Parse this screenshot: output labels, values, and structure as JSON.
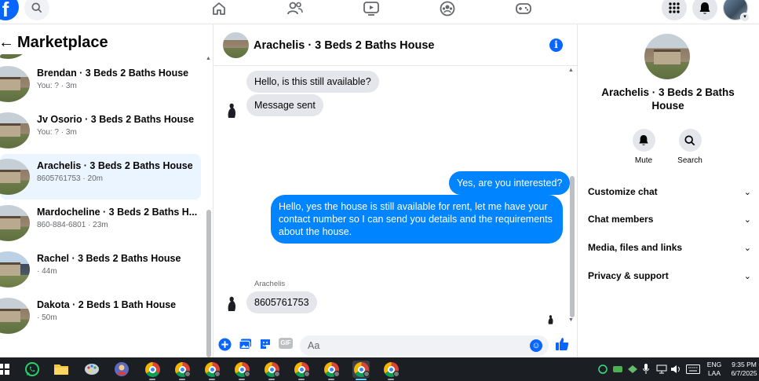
{
  "topbar": {
    "logo_letter": "f",
    "icons": [
      "search-icon",
      "home-icon",
      "friends-icon",
      "watch-icon",
      "groups-icon",
      "gaming-icon",
      "menu-icon",
      "notifications-icon",
      "profile-avatar"
    ]
  },
  "sidebar": {
    "title": "Marketplace",
    "conversations": [
      {
        "name": "Brendan · 3 Beds 2 Baths House",
        "sub": "You: ? · 3m"
      },
      {
        "name": "Jv Osorio · 3 Beds 2 Baths House",
        "sub": "You: ? · 3m"
      },
      {
        "name": "Arachelis · 3 Beds 2 Baths House",
        "sub": "8605761753 · 20m",
        "active": true
      },
      {
        "name": "Mardocheline · 3 Beds 2 Baths H...",
        "sub": "860-884-6801 · 23m"
      },
      {
        "name": "Rachel · 3 Beds 2 Baths House",
        "sub": "· 44m"
      },
      {
        "name": "Dakota · 2 Beds 1 Bath House",
        "sub": "· 50m"
      }
    ]
  },
  "chat": {
    "title": "Arachelis · 3 Beds 2 Baths House",
    "messages": {
      "in1": "Hello, is this still available?",
      "in2": "Message sent",
      "out1": "Yes, are you interested?",
      "out2": "Hello, yes the house is still available for rent, let me have your contact number so I can send you details and the requirements about the house.",
      "sender_label": "Arachelis",
      "in3": "8605761753"
    },
    "composer": {
      "placeholder": "Aa",
      "gif_label": "GIF"
    }
  },
  "details": {
    "name": "Arachelis · 3 Beds 2 Baths House",
    "actions": {
      "mute": "Mute",
      "search": "Search"
    },
    "sections": [
      "Customize chat",
      "Chat members",
      "Media, files and links",
      "Privacy & support"
    ]
  },
  "taskbar": {
    "lang": "ENG",
    "layout": "LAA",
    "time": "9:35 PM",
    "date": "6/7/2025"
  },
  "colors": {
    "brand_blue": "#0866ff",
    "outgoing_bubble": "#0084ff",
    "incoming_bubble": "#e4e6eb",
    "active_row": "#ebf5ff",
    "taskbar": "#1b1f24"
  }
}
